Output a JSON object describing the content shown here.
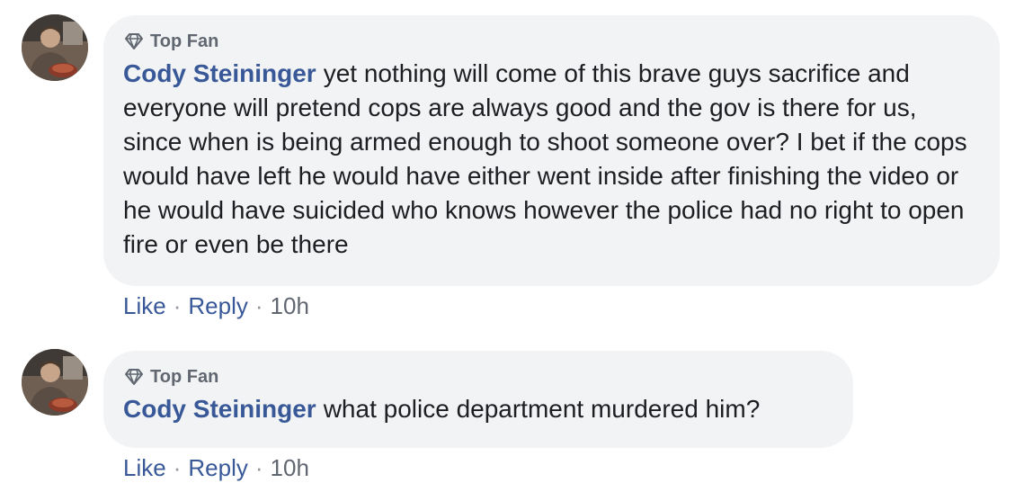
{
  "comments": [
    {
      "badge": "Top Fan",
      "author": "Cody Steininger",
      "text": "yet nothing will come of this brave guys sacrifice and everyone will pretend cops are always good and the gov is there for us, since when is being armed enough to shoot someone over? I bet if the cops would have left he would have either went inside after finishing the video or he would have suicided who knows however the police had no right to open fire or even be there",
      "actions": {
        "like": "Like",
        "reply": "Reply",
        "separator": "·",
        "time": "10h"
      }
    },
    {
      "badge": "Top Fan",
      "author": "Cody Steininger",
      "text": "what police department murdered him?",
      "actions": {
        "like": "Like",
        "reply": "Reply",
        "separator": "·",
        "time": "10h"
      }
    }
  ],
  "icons": {
    "badge": "diamond-icon",
    "avatar": "profile-photo"
  },
  "colors": {
    "author": "#385898",
    "bubble": "#f2f3f5",
    "badge_text": "#606770",
    "action_link": "#385898"
  }
}
